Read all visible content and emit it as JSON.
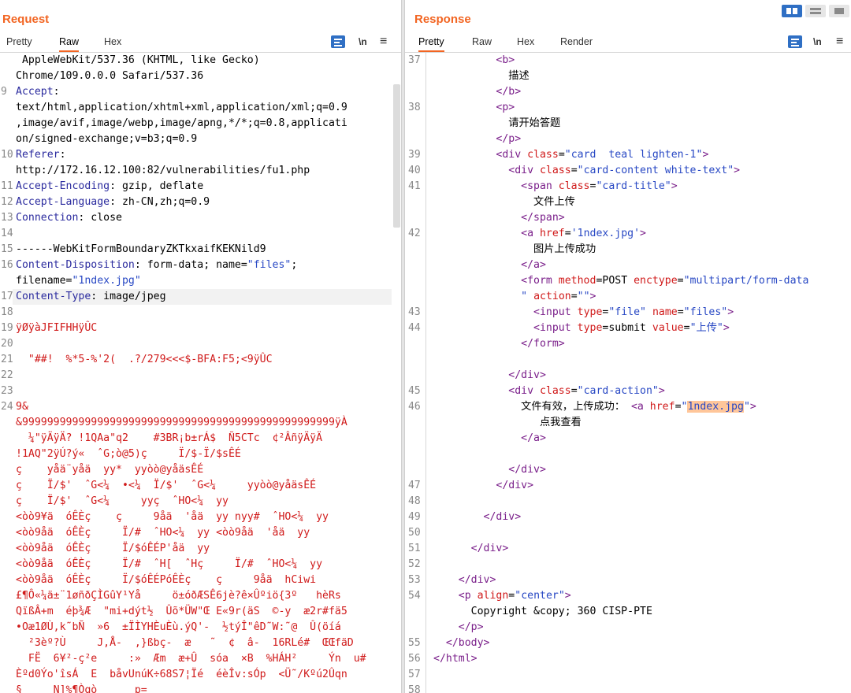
{
  "request": {
    "title": "Request",
    "tabs": [
      "Pretty",
      "Raw",
      "Hex"
    ],
    "active_tab": "Raw",
    "newline_toggle": "\\n",
    "lines": [
      {
        "n": "",
        "segs": [
          {
            "c": "plain",
            "t": " AppleWebKit/537.36 (KHTML, like Gecko)"
          }
        ]
      },
      {
        "n": "",
        "segs": [
          {
            "c": "plain",
            "t": "Chrome/109.0.0.0 Safari/537.36"
          }
        ]
      },
      {
        "n": "9",
        "segs": [
          {
            "c": "k",
            "t": "Accept"
          },
          {
            "c": "plain",
            "t": ":"
          }
        ]
      },
      {
        "n": "",
        "segs": [
          {
            "c": "plain",
            "t": "text/html,application/xhtml+xml,application/xml;q=0.9"
          }
        ]
      },
      {
        "n": "",
        "segs": [
          {
            "c": "plain",
            "t": ",image/avif,image/webp,image/apng,*/*;q=0.8,applicati"
          }
        ]
      },
      {
        "n": "",
        "segs": [
          {
            "c": "plain",
            "t": "on/signed-exchange;v=b3;q=0.9"
          }
        ]
      },
      {
        "n": "10",
        "segs": [
          {
            "c": "k",
            "t": "Referer"
          },
          {
            "c": "plain",
            "t": ":"
          }
        ]
      },
      {
        "n": "",
        "segs": [
          {
            "c": "plain",
            "t": "http://172.16.12.100:82/vulnerabilities/fu1.php"
          }
        ]
      },
      {
        "n": "11",
        "segs": [
          {
            "c": "k",
            "t": "Accept-Encoding"
          },
          {
            "c": "plain",
            "t": ": gzip, deflate"
          }
        ]
      },
      {
        "n": "12",
        "segs": [
          {
            "c": "k",
            "t": "Accept-Language"
          },
          {
            "c": "plain",
            "t": ": zh-CN,zh;q=0.9"
          }
        ]
      },
      {
        "n": "13",
        "segs": [
          {
            "c": "k",
            "t": "Connection"
          },
          {
            "c": "plain",
            "t": ": close"
          }
        ]
      },
      {
        "n": "14",
        "segs": []
      },
      {
        "n": "15",
        "segs": [
          {
            "c": "plain",
            "t": "------WebKitFormBoundaryZKTkxaifKEKNild9"
          }
        ]
      },
      {
        "n": "16",
        "segs": [
          {
            "c": "k",
            "t": "Content-Disposition"
          },
          {
            "c": "plain",
            "t": ": form-data; name="
          },
          {
            "c": "s",
            "t": "\"files\""
          },
          {
            "c": "plain",
            "t": ";"
          }
        ]
      },
      {
        "n": "",
        "segs": [
          {
            "c": "plain",
            "t": "filename="
          },
          {
            "c": "s",
            "t": "\"1ndex.jpg\""
          }
        ]
      },
      {
        "n": "17",
        "segs": [
          {
            "c": "k",
            "t": "Content-Type"
          },
          {
            "c": "plain",
            "t": ": image/jpeg"
          }
        ]
      },
      {
        "n": "18",
        "segs": []
      },
      {
        "n": "19",
        "segs": [
          {
            "c": "bin",
            "t": "ÿØÿàJFIFHHÿÛC"
          }
        ]
      },
      {
        "n": "20",
        "segs": []
      },
      {
        "n": "21",
        "segs": [
          {
            "c": "bin",
            "t": "  \"##!  %*5-%'2(  .?/279<<<$-BFA:F5;<9ÿÛC"
          }
        ]
      },
      {
        "n": "22",
        "segs": []
      },
      {
        "n": "23",
        "segs": []
      },
      {
        "n": "24",
        "segs": [
          {
            "c": "bin",
            "t": "9&"
          }
        ]
      },
      {
        "n": "",
        "segs": [
          {
            "c": "bin",
            "t": "&99999999999999999999999999999999999999999999999999ÿÀ"
          }
        ]
      },
      {
        "n": "",
        "segs": [
          {
            "c": "bin",
            "t": "  ¼\"ÿÄÿÄ? !1QAa\"q2    #3BR¡b±rÁ$  Ñ5CTc  ¢²ÂñÿÄÿÄ"
          }
        ]
      },
      {
        "n": "",
        "segs": [
          {
            "c": "bin",
            "t": "!1AQ\"2ÿÚ?ý«  ˆG;ò@5)ç     Ï/$-Ï/$sÊÉ"
          }
        ]
      },
      {
        "n": "",
        "segs": [
          {
            "c": "bin",
            "t": "ç    yåä¨yåä  yy*  yyòò@yåäsÊÉ"
          }
        ]
      },
      {
        "n": "",
        "segs": [
          {
            "c": "bin",
            "t": "ç    Ï/$'  ˆG<¼  •<¼  Ï/$'  ˆG<¼     yyòò@yåäsÊÉ"
          }
        ]
      },
      {
        "n": "",
        "segs": [
          {
            "c": "bin",
            "t": "ç    Ï/$'  ˆG<¼     yyç  ˆHO<¼  yy"
          }
        ]
      },
      {
        "n": "",
        "segs": [
          {
            "c": "bin",
            "t": "<òò9¥ä  óÊÈç    ç     9åä  'åä  yy nyy#  ˆHO<¼  yy"
          }
        ]
      },
      {
        "n": "",
        "segs": [
          {
            "c": "bin",
            "t": "<òò9åä  óÊÈç     Ï/#  ˆHO<¼  yy <òò9åä  'åä  yy"
          }
        ]
      },
      {
        "n": "",
        "segs": [
          {
            "c": "bin",
            "t": "<òò9åä  óÊÈç     Ï/$óÊÉP'åä  yy"
          }
        ]
      },
      {
        "n": "",
        "segs": [
          {
            "c": "bin",
            "t": "<òò9åä  óÊÈç     Ï/#  ˆH[  ˆHç     Ï/#  ˆHO<¼  yy"
          }
        ]
      },
      {
        "n": "",
        "segs": [
          {
            "c": "bin",
            "t": "<òò9åä  óÊÈç     Ï/$óÊÉPóÊÈç    ç     9åä  hCiwi"
          }
        ]
      },
      {
        "n": "",
        "segs": [
          {
            "c": "bin",
            "t": "£¶Ô«¼ä±¨1øñðÇÌGûY¹Yå     ö±óðÆSÊ6jè?ê×Ûºiö{3º   hèRs"
          }
        ]
      },
      {
        "n": "",
        "segs": [
          {
            "c": "bin",
            "t": "QïßÂ+m  éþ¾Æ  \"mi+dýt½  Ûõ*ÜW\"Œ E«9r(äS  ©-y  æ2r#fä5"
          }
        ]
      },
      {
        "n": "",
        "segs": [
          {
            "c": "bin",
            "t": "•Oæ1ØÙ,k˜bÑ  »6  ±ÏÌYHÈuÈù.ýQ'-  ½týÎ\"êD˜W:˜@  Û(öíá"
          }
        ]
      },
      {
        "n": "",
        "segs": [
          {
            "c": "bin",
            "t": "  ²3èº?Ù     J,Å-  ,}ßbç-  æ   ˜  ¢  â-  16RLé#  ŒŒfäD"
          }
        ]
      },
      {
        "n": "",
        "segs": [
          {
            "c": "bin",
            "t": "  FË  6¥²-ç²e     :»  Æm  æ+Û  sóa  ×B  %HÁH²     Ýn  u#"
          }
        ]
      },
      {
        "n": "",
        "segs": [
          {
            "c": "bin",
            "t": "Èºd0Ýo'îsÁ  E  båvUnúK÷68S7¦Ïé  éèÎv:sÓp  <Ü˜/Kºú2Ûqn"
          }
        ]
      },
      {
        "n": "",
        "segs": [
          {
            "c": "bin",
            "t": "§     N]%¶Òqò     _p="
          }
        ]
      }
    ]
  },
  "response": {
    "title": "Response",
    "tabs": [
      "Pretty",
      "Raw",
      "Hex",
      "Render"
    ],
    "active_tab": "Pretty",
    "newline_toggle": "\\n",
    "lines": [
      {
        "n": "37",
        "segs": [
          {
            "c": "plain",
            "t": "          "
          },
          {
            "c": "t",
            "t": "<b>"
          }
        ]
      },
      {
        "n": "",
        "segs": [
          {
            "c": "plain",
            "t": "            描述"
          }
        ]
      },
      {
        "n": "",
        "segs": [
          {
            "c": "plain",
            "t": "          "
          },
          {
            "c": "t",
            "t": "</b>"
          }
        ]
      },
      {
        "n": "38",
        "segs": [
          {
            "c": "plain",
            "t": "          "
          },
          {
            "c": "t",
            "t": "<p>"
          }
        ]
      },
      {
        "n": "",
        "segs": [
          {
            "c": "plain",
            "t": "            请开始答题"
          }
        ]
      },
      {
        "n": "",
        "segs": [
          {
            "c": "plain",
            "t": "          "
          },
          {
            "c": "t",
            "t": "</p>"
          }
        ]
      },
      {
        "n": "39",
        "segs": [
          {
            "c": "plain",
            "t": "          "
          },
          {
            "c": "t",
            "t": "<div "
          },
          {
            "c": "a",
            "t": "class"
          },
          {
            "c": "plain",
            "t": "="
          },
          {
            "c": "s",
            "t": "\"card  teal lighten-1\""
          },
          {
            "c": "t",
            "t": ">"
          }
        ]
      },
      {
        "n": "40",
        "segs": [
          {
            "c": "plain",
            "t": "            "
          },
          {
            "c": "t",
            "t": "<div "
          },
          {
            "c": "a",
            "t": "class"
          },
          {
            "c": "plain",
            "t": "="
          },
          {
            "c": "s",
            "t": "\"card-content white-text\""
          },
          {
            "c": "t",
            "t": ">"
          }
        ]
      },
      {
        "n": "41",
        "segs": [
          {
            "c": "plain",
            "t": "              "
          },
          {
            "c": "t",
            "t": "<span "
          },
          {
            "c": "a",
            "t": "class"
          },
          {
            "c": "plain",
            "t": "="
          },
          {
            "c": "s",
            "t": "\"card-title\""
          },
          {
            "c": "t",
            "t": ">"
          }
        ]
      },
      {
        "n": "",
        "segs": [
          {
            "c": "plain",
            "t": "                文件上传"
          }
        ]
      },
      {
        "n": "",
        "segs": [
          {
            "c": "plain",
            "t": "              "
          },
          {
            "c": "t",
            "t": "</span>"
          }
        ]
      },
      {
        "n": "42",
        "segs": [
          {
            "c": "plain",
            "t": "              "
          },
          {
            "c": "t",
            "t": "<a "
          },
          {
            "c": "a",
            "t": "href"
          },
          {
            "c": "plain",
            "t": "="
          },
          {
            "c": "s",
            "t": "'1ndex.jpg'"
          },
          {
            "c": "t",
            "t": ">"
          }
        ]
      },
      {
        "n": "",
        "segs": [
          {
            "c": "plain",
            "t": "                图片上传成功"
          }
        ]
      },
      {
        "n": "",
        "segs": [
          {
            "c": "plain",
            "t": "              "
          },
          {
            "c": "t",
            "t": "</a>"
          }
        ]
      },
      {
        "n": "",
        "segs": [
          {
            "c": "plain",
            "t": "              "
          },
          {
            "c": "t",
            "t": "<form "
          },
          {
            "c": "a",
            "t": "method"
          },
          {
            "c": "plain",
            "t": "=POST "
          },
          {
            "c": "a",
            "t": "enctype"
          },
          {
            "c": "plain",
            "t": "="
          },
          {
            "c": "s",
            "t": "\"multipart/form-data"
          }
        ]
      },
      {
        "n": "",
        "segs": [
          {
            "c": "plain",
            "t": "              "
          },
          {
            "c": "s",
            "t": "\""
          },
          {
            "c": "plain",
            "t": " "
          },
          {
            "c": "a",
            "t": "action"
          },
          {
            "c": "plain",
            "t": "="
          },
          {
            "c": "s",
            "t": "\"\""
          },
          {
            "c": "t",
            "t": ">"
          }
        ]
      },
      {
        "n": "43",
        "segs": [
          {
            "c": "plain",
            "t": "                "
          },
          {
            "c": "t",
            "t": "<input "
          },
          {
            "c": "a",
            "t": "type"
          },
          {
            "c": "plain",
            "t": "="
          },
          {
            "c": "s",
            "t": "\"file\""
          },
          {
            "c": "plain",
            "t": " "
          },
          {
            "c": "a",
            "t": "name"
          },
          {
            "c": "plain",
            "t": "="
          },
          {
            "c": "s",
            "t": "\"files\""
          },
          {
            "c": "t",
            "t": ">"
          }
        ]
      },
      {
        "n": "44",
        "segs": [
          {
            "c": "plain",
            "t": "                "
          },
          {
            "c": "t",
            "t": "<input "
          },
          {
            "c": "a",
            "t": "type"
          },
          {
            "c": "plain",
            "t": "=submit "
          },
          {
            "c": "a",
            "t": "value"
          },
          {
            "c": "plain",
            "t": "="
          },
          {
            "c": "s",
            "t": "\"上传\""
          },
          {
            "c": "t",
            "t": ">"
          }
        ]
      },
      {
        "n": "",
        "segs": [
          {
            "c": "plain",
            "t": "              "
          },
          {
            "c": "t",
            "t": "</form>"
          }
        ]
      },
      {
        "n": "",
        "segs": []
      },
      {
        "n": "",
        "segs": [
          {
            "c": "plain",
            "t": "            "
          },
          {
            "c": "t",
            "t": "</div>"
          }
        ]
      },
      {
        "n": "45",
        "segs": [
          {
            "c": "plain",
            "t": "            "
          },
          {
            "c": "t",
            "t": "<div "
          },
          {
            "c": "a",
            "t": "class"
          },
          {
            "c": "plain",
            "t": "="
          },
          {
            "c": "s",
            "t": "\"card-action\""
          },
          {
            "c": "t",
            "t": ">"
          }
        ]
      },
      {
        "n": "46",
        "segs": [
          {
            "c": "plain",
            "t": "              文件有效，上传成功： "
          },
          {
            "c": "t",
            "t": "<a "
          },
          {
            "c": "a",
            "t": "href"
          },
          {
            "c": "plain",
            "t": "="
          },
          {
            "c": "s",
            "t": "\""
          },
          {
            "c": "shl",
            "t": "1ndex.jpg"
          },
          {
            "c": "s",
            "t": "\""
          },
          {
            "c": "t",
            "t": ">"
          }
        ]
      },
      {
        "n": "",
        "segs": [
          {
            "c": "plain",
            "t": "                 点我查看"
          }
        ]
      },
      {
        "n": "",
        "segs": [
          {
            "c": "plain",
            "t": "              "
          },
          {
            "c": "t",
            "t": "</a>"
          }
        ]
      },
      {
        "n": "",
        "segs": []
      },
      {
        "n": "",
        "segs": [
          {
            "c": "plain",
            "t": "            "
          },
          {
            "c": "t",
            "t": "</div>"
          }
        ]
      },
      {
        "n": "47",
        "segs": [
          {
            "c": "plain",
            "t": "          "
          },
          {
            "c": "t",
            "t": "</div>"
          }
        ]
      },
      {
        "n": "48",
        "segs": []
      },
      {
        "n": "49",
        "segs": [
          {
            "c": "plain",
            "t": "        "
          },
          {
            "c": "t",
            "t": "</div>"
          }
        ]
      },
      {
        "n": "50",
        "segs": []
      },
      {
        "n": "51",
        "segs": [
          {
            "c": "plain",
            "t": "      "
          },
          {
            "c": "t",
            "t": "</div>"
          }
        ]
      },
      {
        "n": "52",
        "segs": []
      },
      {
        "n": "53",
        "segs": [
          {
            "c": "plain",
            "t": "    "
          },
          {
            "c": "t",
            "t": "</div>"
          }
        ]
      },
      {
        "n": "54",
        "segs": [
          {
            "c": "plain",
            "t": "    "
          },
          {
            "c": "t",
            "t": "<p "
          },
          {
            "c": "a",
            "t": "align"
          },
          {
            "c": "plain",
            "t": "="
          },
          {
            "c": "s",
            "t": "\"center\""
          },
          {
            "c": "t",
            "t": ">"
          }
        ]
      },
      {
        "n": "",
        "segs": [
          {
            "c": "plain",
            "t": "      Copyright &copy; 360 CISP-PTE"
          }
        ]
      },
      {
        "n": "",
        "segs": [
          {
            "c": "plain",
            "t": "    "
          },
          {
            "c": "t",
            "t": "</p>"
          }
        ]
      },
      {
        "n": "55",
        "segs": [
          {
            "c": "plain",
            "t": "  "
          },
          {
            "c": "t",
            "t": "</body>"
          }
        ]
      },
      {
        "n": "56",
        "segs": [
          {
            "c": "t",
            "t": "</html>"
          }
        ]
      },
      {
        "n": "57",
        "segs": []
      },
      {
        "n": "58",
        "segs": []
      }
    ]
  },
  "colors": {
    "accent": "#f26522",
    "toolbar_blue": "#2f6fc4",
    "tag": "#7a1f8a",
    "attribute": "#d01a1a",
    "string": "#2848c4",
    "header_key": "#2a2a9e",
    "search_highlight": "#ffc69a"
  },
  "icons": [
    "wrap-lines-icon",
    "menu-icon",
    "layout-split-horizontal-icon",
    "layout-split-vertical-icon",
    "layout-single-icon"
  ]
}
